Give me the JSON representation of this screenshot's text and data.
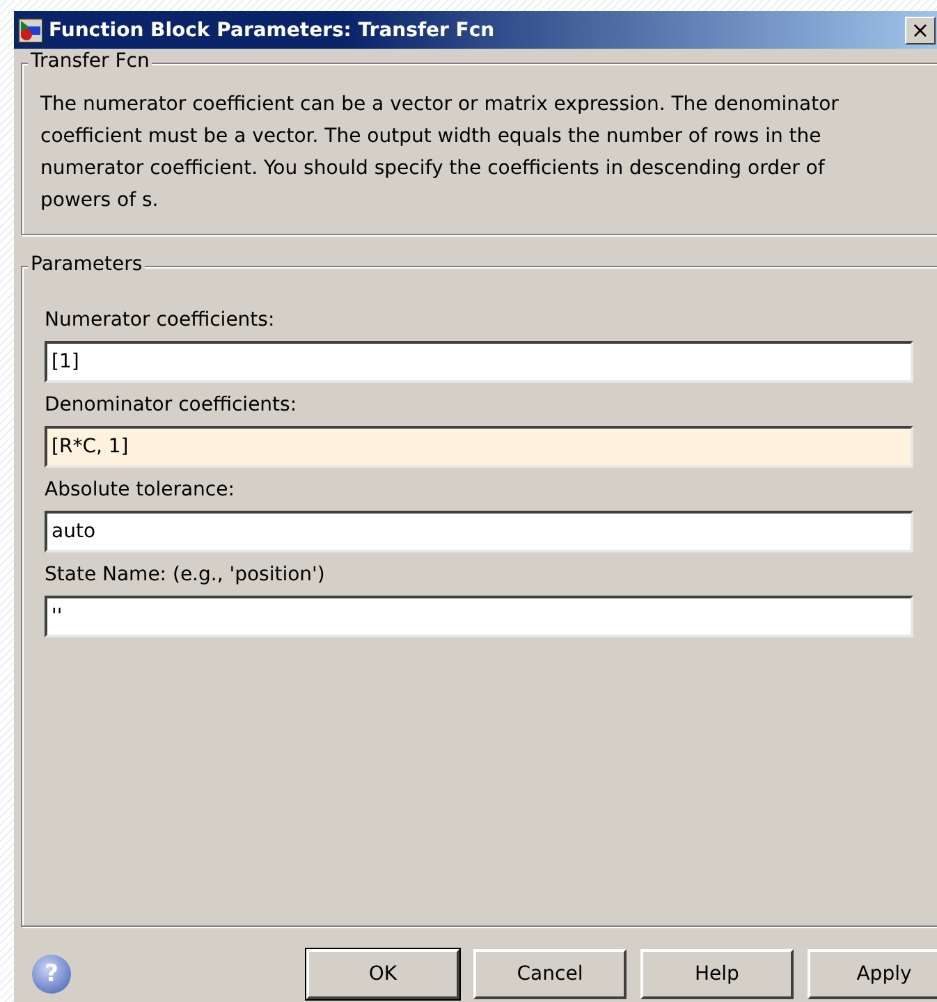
{
  "window": {
    "title": "Function Block Parameters: Transfer Fcn",
    "close": "×"
  },
  "description_group": {
    "title": "Transfer Fcn",
    "text": "The numerator coefficient can be a vector or matrix expression. The denominator coefficient must be a vector. The output width equals the number of rows in the numerator coefficient. You should specify the coefficients in descending order of powers of s."
  },
  "parameters_group": {
    "title": "Parameters",
    "fields": [
      {
        "label": "Numerator coefficients:",
        "value": "[1]",
        "focused": false
      },
      {
        "label": "Denominator coefficients:",
        "value": "[R*C, 1]",
        "focused": true
      },
      {
        "label": "Absolute tolerance:",
        "value": "auto",
        "focused": false
      },
      {
        "label": "State Name: (e.g., 'position')",
        "value": "''",
        "focused": false
      }
    ]
  },
  "help_icon": "?",
  "buttons": [
    {
      "label": "OK",
      "default": true
    },
    {
      "label": "Cancel",
      "default": false
    },
    {
      "label": "Help",
      "default": false
    },
    {
      "label": "Apply",
      "default": false
    }
  ]
}
